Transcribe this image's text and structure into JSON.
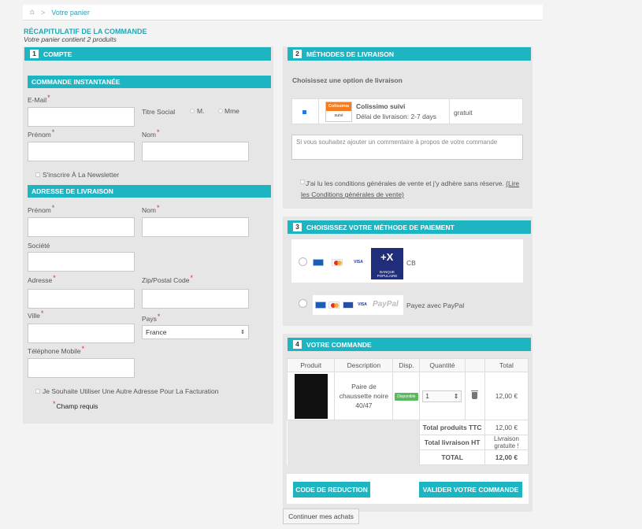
{
  "breadcrumb": {
    "home_icon": "home-icon",
    "separator": ">",
    "current": "Votre panier"
  },
  "summary": {
    "title": "RÉCAPITULATIF DE LA COMMANDE",
    "subtitle": "Votre panier contient 2 produits"
  },
  "colors": {
    "accent": "#1eb5c3",
    "panel": "#e6e6e6",
    "required": "#e0303a"
  },
  "account": {
    "number": "1",
    "title": "COMPTE",
    "instant_title": "COMMANDE INSTANTANÉE",
    "email_label": "E-Mail",
    "title_label": "Titre Social",
    "title_options": [
      "M.",
      "Mme"
    ],
    "firstname_label": "Prénom",
    "lastname_label": "Nom",
    "newsletter_label": "S'inscrire À La Newsletter",
    "delivery_title": "ADRESSE DE LIVRAISON",
    "d_firstname_label": "Prénom",
    "d_lastname_label": "Nom",
    "company_label": "Société",
    "address_label": "Adresse",
    "zip_label": "Zip/Postal Code",
    "city_label": "Ville",
    "country_label": "Pays",
    "country_value": "France",
    "phone_label": "Téléphone Mobile",
    "other_address_label": "Je Souhaite Utiliser Une Autre Adresse Pour La Facturation",
    "required_note": "Champ requis"
  },
  "shipping": {
    "number": "2",
    "title": "MÉTHODES DE LIVRAISON",
    "choose_label": "Choisissez une option de livraison",
    "carrier_name": "Colissimo suivi",
    "carrier_delay": "Délai de livraison: 2-7 days",
    "carrier_price": "gratuit",
    "logo_top": "Colissimo",
    "logo_bottom": "suivi",
    "comment_placeholder": "Si vous souhaitez ajouter un commentaire à propos de votre commande",
    "terms_text": "J'ai lu les conditions générales de vente et j'y adhère sans réserve.",
    "terms_link": "(Lire les Conditions générales de vente)"
  },
  "payment": {
    "number": "3",
    "title": "CHOISISSEZ VOTRE MÉTHODE DE PAIEMENT",
    "option1_label": "CB",
    "bank_logo_text": "BANQUE POPULAIRE",
    "option2_label": "Payez avec PayPal",
    "paypal_logo": "PayPal"
  },
  "order": {
    "number": "4",
    "title": "VOTRE COMMANDE",
    "headers": [
      "Produit",
      "Description",
      "Disp.",
      "Quantité",
      "",
      "Total"
    ],
    "item": {
      "description": "Paire de chaussette noire 40/47",
      "availability": "Disponible",
      "quantity": "1",
      "total": "12,00 €"
    },
    "totals": [
      {
        "label": "Total produits TTC",
        "value": "12,00 €"
      },
      {
        "label": "Total livraison HT",
        "value": "Livraison gratuite !"
      },
      {
        "label": "TOTAL",
        "value": "12,00 €"
      }
    ],
    "discount_button": "CODE DE REDUCTION",
    "validate_button": "VALIDER VOTRE COMMANDE",
    "continue_button": "Continuer mes achats"
  }
}
